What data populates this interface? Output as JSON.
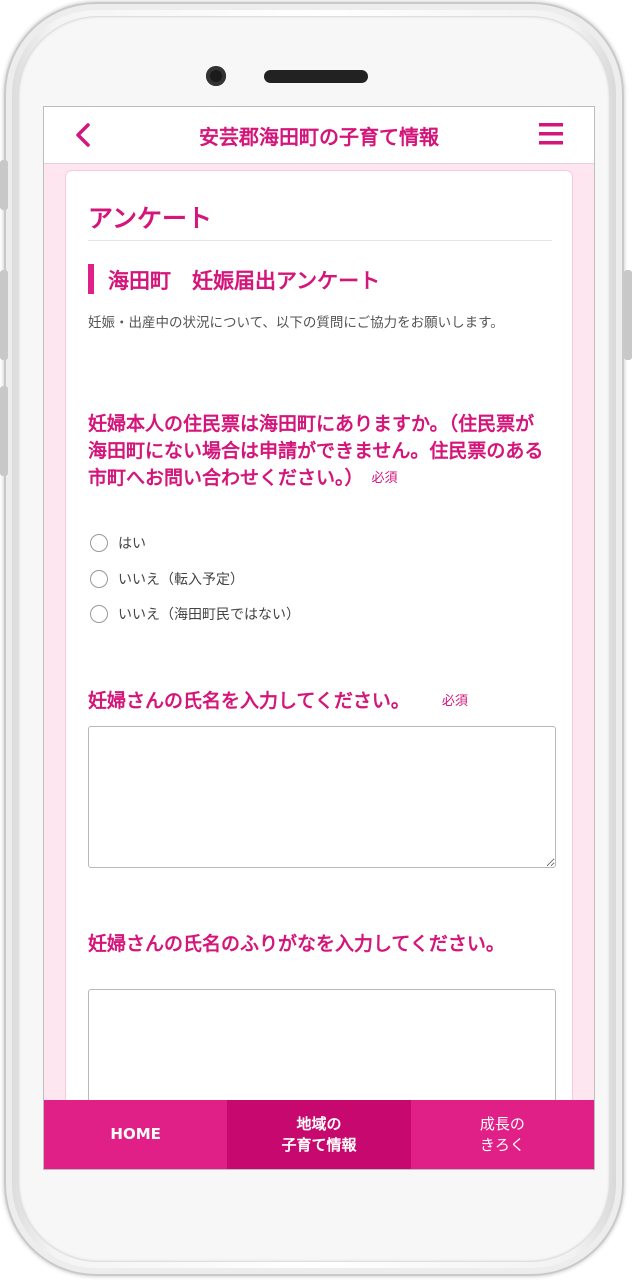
{
  "header": {
    "back_icon": "chevron-left-icon",
    "title": "安芸郡海田町の子育て情報",
    "menu_icon": "hamburger-menu-icon"
  },
  "page": {
    "title": "アンケート",
    "section_title": "海田町　妊娠届出アンケート",
    "intro": "妊娠・出産中の状況について、以下の質問にご協力をお願いします。"
  },
  "questions": [
    {
      "text": "妊婦本人の住民票は海田町にありますか。（住民票が海田町にない場合は申請ができません。住民票のある市町へお問い合わせください。）",
      "required": "必須",
      "options": [
        "はい",
        "いいえ（転入予定）",
        "いいえ（海田町民ではない）"
      ]
    },
    {
      "text": "妊婦さんの氏名を入力してください。",
      "required": "必須",
      "value": ""
    },
    {
      "text": "妊婦さんの氏名のふりがなを入力してください。",
      "value": ""
    }
  ],
  "bottom_nav": [
    {
      "line1": "HOME",
      "line2": ""
    },
    {
      "line1": "地域の",
      "line2": "子育て情報"
    },
    {
      "line1": "成長の",
      "line2": "きろく"
    }
  ],
  "colors": {
    "accent": "#d4157a",
    "nav_bg": "#e01f87",
    "nav_active": "#c7096f"
  }
}
